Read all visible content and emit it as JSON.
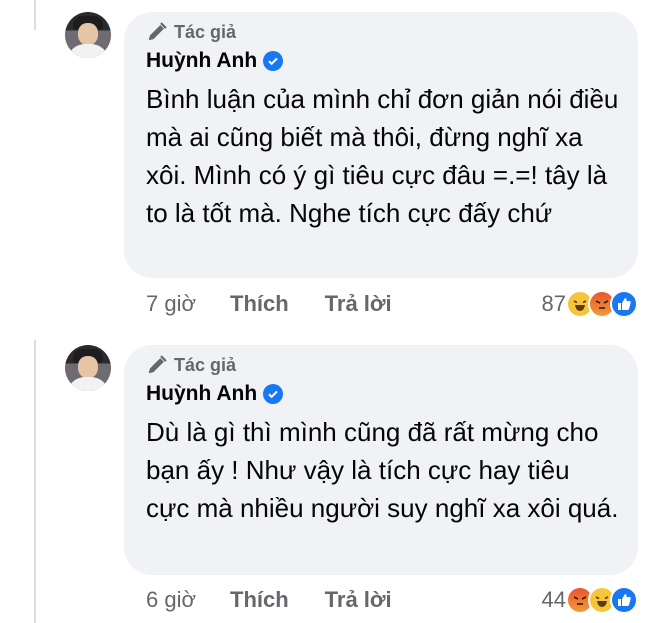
{
  "comments": [
    {
      "author_tag": "Tác giả",
      "author_name": "Huỳnh Anh",
      "text": "Bình luận của mình chỉ đơn giản nói điều mà ai cũng biết mà thôi, đừng nghĩ xa xôi. Mình có ý gì tiêu cực đâu =.=! tây là to là tốt mà. Nghe tích cực đấy chứ",
      "time": "7 giờ",
      "like_action": "Thích",
      "reply_action": "Trả lời",
      "reaction_count": "87",
      "reactions": [
        "haha-icon",
        "angry-icon",
        "like-icon"
      ]
    },
    {
      "author_tag": "Tác giả",
      "author_name": "Huỳnh Anh",
      "text": "Dù là gì thì mình cũng đã rất mừng cho bạn ấy ! Như vậy là tích cực hay tiêu cực mà nhiều người suy nghĩ xa xôi quá.",
      "time": "6 giờ",
      "like_action": "Thích",
      "reply_action": "Trả lời",
      "reaction_count": "44",
      "reactions": [
        "angry-icon",
        "haha-icon",
        "like-icon"
      ]
    }
  ],
  "colors": {
    "bubble": "#f0f2f5",
    "muted_text": "#65676b",
    "verified": "#1877f2"
  }
}
